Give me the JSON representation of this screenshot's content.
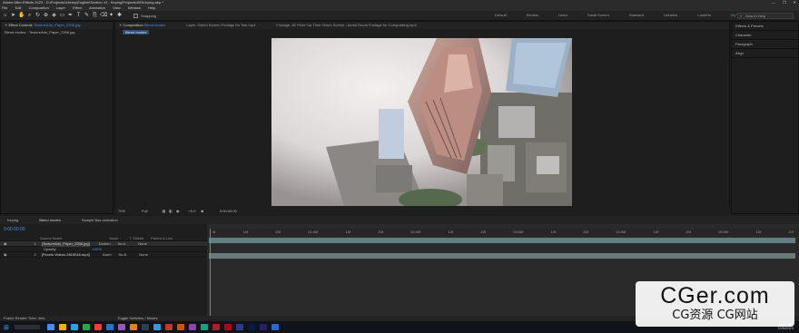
{
  "window": {
    "title": "Adobe After Effects 2023 - D:\\Projects\\Udemy\\English\\Section 10 - Keying\\Projects\\AE\\Keying.aep *",
    "controls": [
      "—",
      "❐",
      "✕"
    ]
  },
  "menu": [
    "File",
    "Edit",
    "Composition",
    "Layer",
    "Effect",
    "Animation",
    "View",
    "Window",
    "Help"
  ],
  "toolbar": {
    "snapping_label": "Snapping",
    "workspaces": [
      "Default",
      "Review",
      "Learn",
      "Small Screen",
      "Standard",
      "Libraries",
      "Look/Hs",
      "My Workspace"
    ],
    "active_workspace": "My Workspace",
    "search_placeholder": "Search Help"
  },
  "effect_controls": {
    "tab_label": "Effect Controls",
    "tab_file": "Texture/Adn_Paper_2306.jpg",
    "breadcrumb": "Blend modes · TextureAdn_Paper_2306.jpg"
  },
  "composition": {
    "tab_label": "Composition",
    "tab_name": "Blend modes",
    "layer_tab": "Layer: Green Screen Footage for Test.mp4",
    "footage_tab": "Footage: 4K Pixel Car Time Green Screen - Aerial Drone Footage for Compositing.mp4",
    "sub_tab": "Blend modes",
    "zoom": "70%",
    "resolution": "Full",
    "exposure": "+0.0",
    "timecode": "0:00:00:00"
  },
  "right_panel": {
    "items": [
      "Effects & Presets",
      "Character",
      "Paragraph",
      "Align"
    ]
  },
  "timeline": {
    "tabs": [
      "Keying",
      "Blend modes",
      "Sample Bas animation"
    ],
    "timecode": "0:00:00:00",
    "columns": [
      "Source Name",
      "Mode",
      "T TrkMat",
      "Parent & Link"
    ],
    "layers": [
      {
        "num": "1",
        "name": "[TextureAdn_Paper_2306.jpg]",
        "mode": "Darken",
        "trkmat": "No A",
        "parent": "None",
        "sub": "Opacity",
        "sub_value": "100%"
      },
      {
        "num": "2",
        "name": "[Pexels Videos 2818046.mp4]",
        "mode": "Norm",
        "trkmat": "No A",
        "parent": "None"
      }
    ],
    "ruler_labels": [
      "0f",
      "10f",
      "20f",
      "01:00f",
      "10f",
      "20f",
      "02:00f",
      "10f",
      "20f",
      "03:00f",
      "10f",
      "20f",
      "04:00f",
      "10f",
      "20f",
      "05:00f",
      "10f",
      "20f"
    ],
    "status_left": "Frame Render Time: 4ms",
    "status_mid": "Toggle Switches / Modes"
  },
  "taskbar": {
    "clock": "7/25/2023",
    "time": "10:27 AM",
    "colors": [
      "#4a8cf0",
      "#f0b400",
      "#2aa1e0",
      "#27a745",
      "#ea4335",
      "#1a78d0",
      "#9b59b6",
      "#e67e22",
      "#2c3e50",
      "#3498db",
      "#c0392b",
      "#d35400",
      "#8e44ad",
      "#16a085",
      "#a32424",
      "#b3001b",
      "#2d3a8c",
      "#001d4a",
      "#2d1b6e",
      "#2a6ad0"
    ]
  },
  "watermark": {
    "text_big": "CGer.com",
    "text_small": "CG资源 CG网站"
  }
}
